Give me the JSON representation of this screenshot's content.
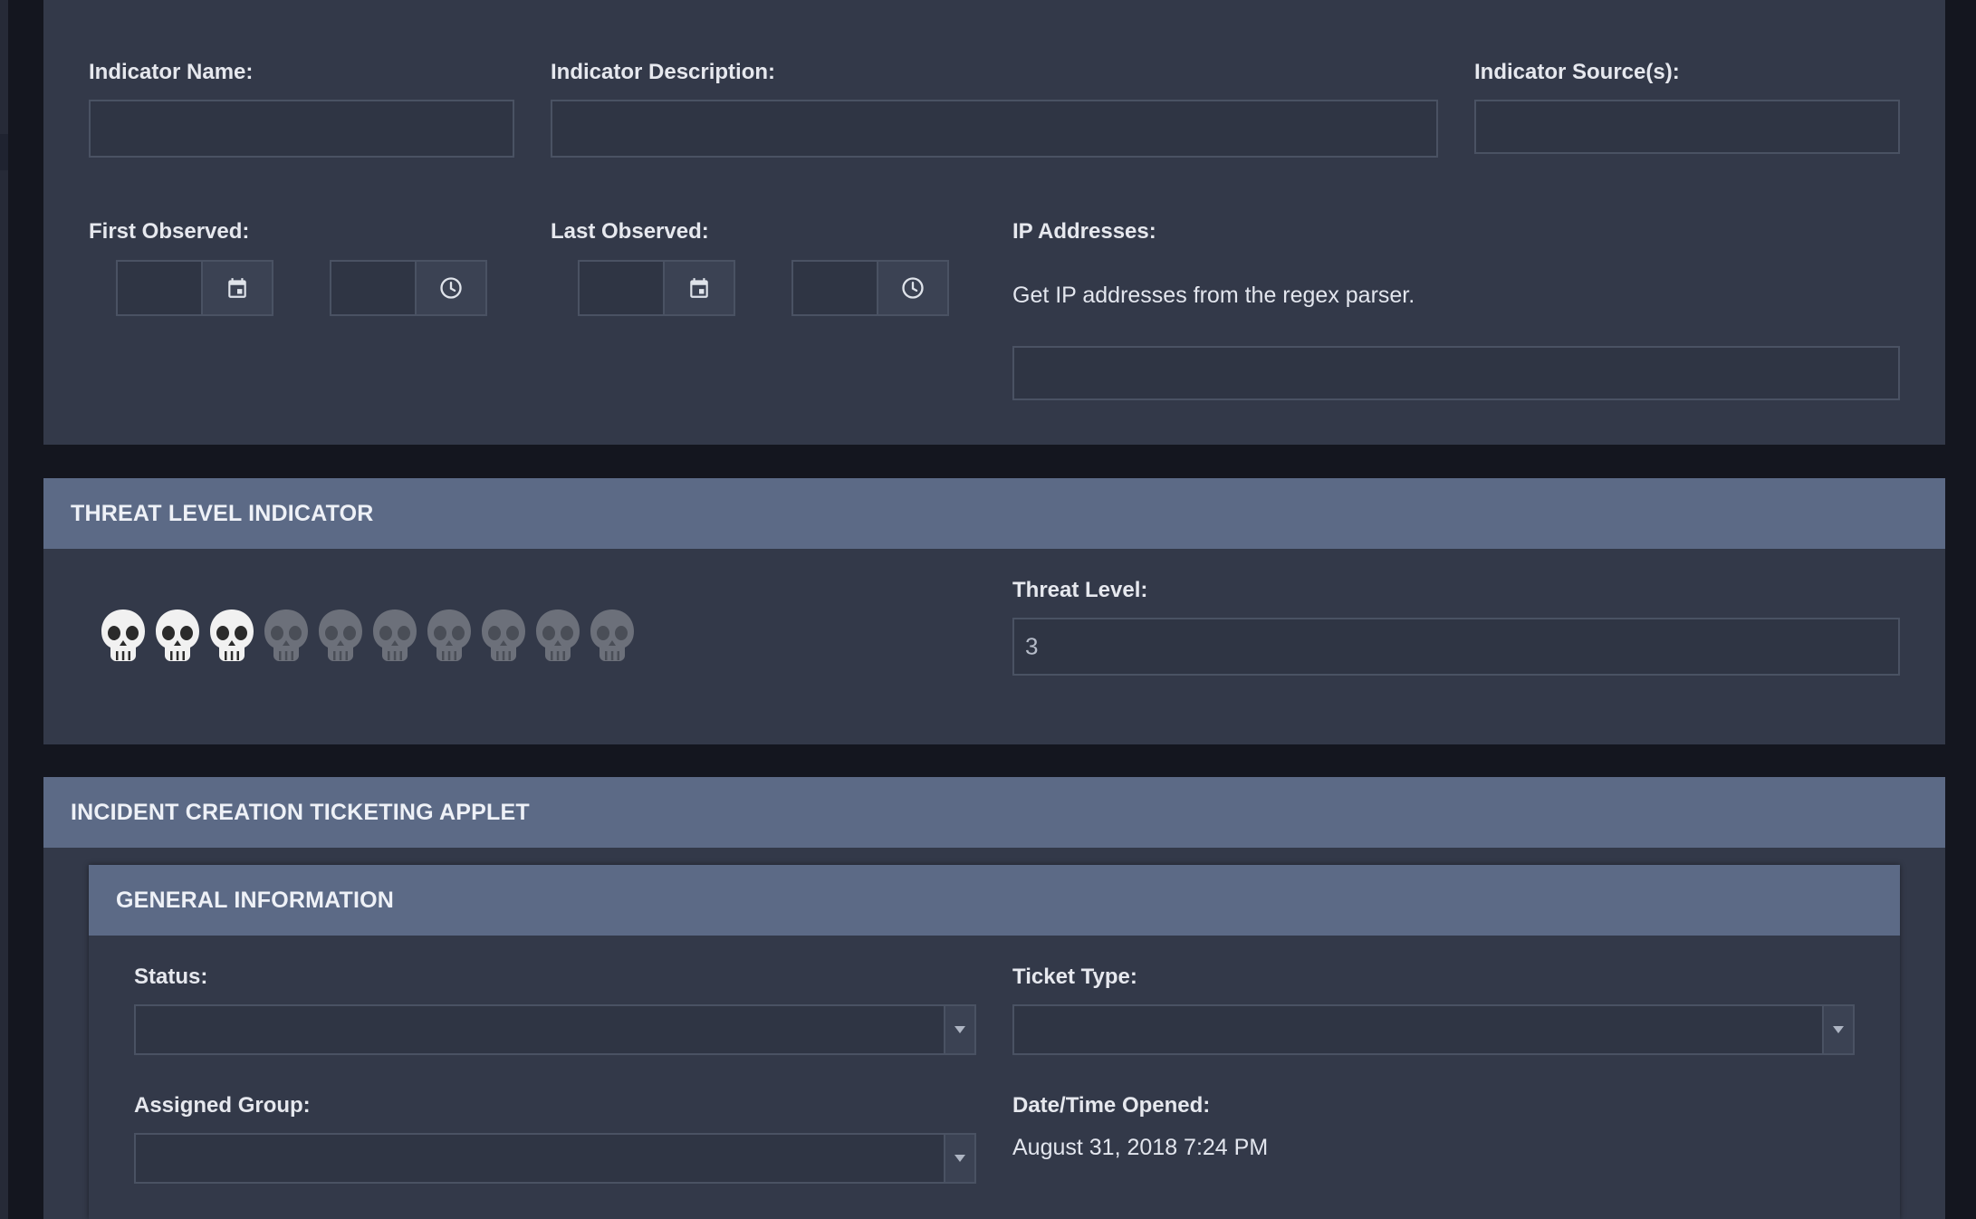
{
  "indicator": {
    "name_label": "Indicator Name:",
    "name_value": "",
    "description_label": "Indicator Description:",
    "description_value": "",
    "sources_label": "Indicator Source(s):",
    "sources_value": "",
    "first_observed_label": "First Observed:",
    "last_observed_label": "Last Observed:",
    "ip_label": "IP Addresses:",
    "ip_help": "Get IP addresses from the regex parser.",
    "ip_value": ""
  },
  "threat": {
    "header": "THREAT LEVEL INDICATOR",
    "level_label": "Threat Level:",
    "level_value": "3",
    "rating": {
      "active": 3,
      "max": 10
    }
  },
  "incident": {
    "header": "INCIDENT CREATION TICKETING APPLET",
    "general_header": "GENERAL INFORMATION",
    "status_label": "Status:",
    "status_value": "",
    "ticket_type_label": "Ticket Type:",
    "ticket_type_value": "",
    "assigned_group_label": "Assigned Group:",
    "assigned_group_value": "",
    "opened_label": "Date/Time Opened:",
    "opened_value": "August 31, 2018 7:24 PM"
  },
  "icons": {
    "calendar": "calendar-icon",
    "clock": "clock-icon",
    "skull": "skull-icon",
    "dropdown": "chevron-down-icon"
  },
  "colors": {
    "panel_bg": "#333949",
    "header_bg": "#5c6a86",
    "page_bg": "#14161f",
    "field_border": "#4a5263"
  }
}
